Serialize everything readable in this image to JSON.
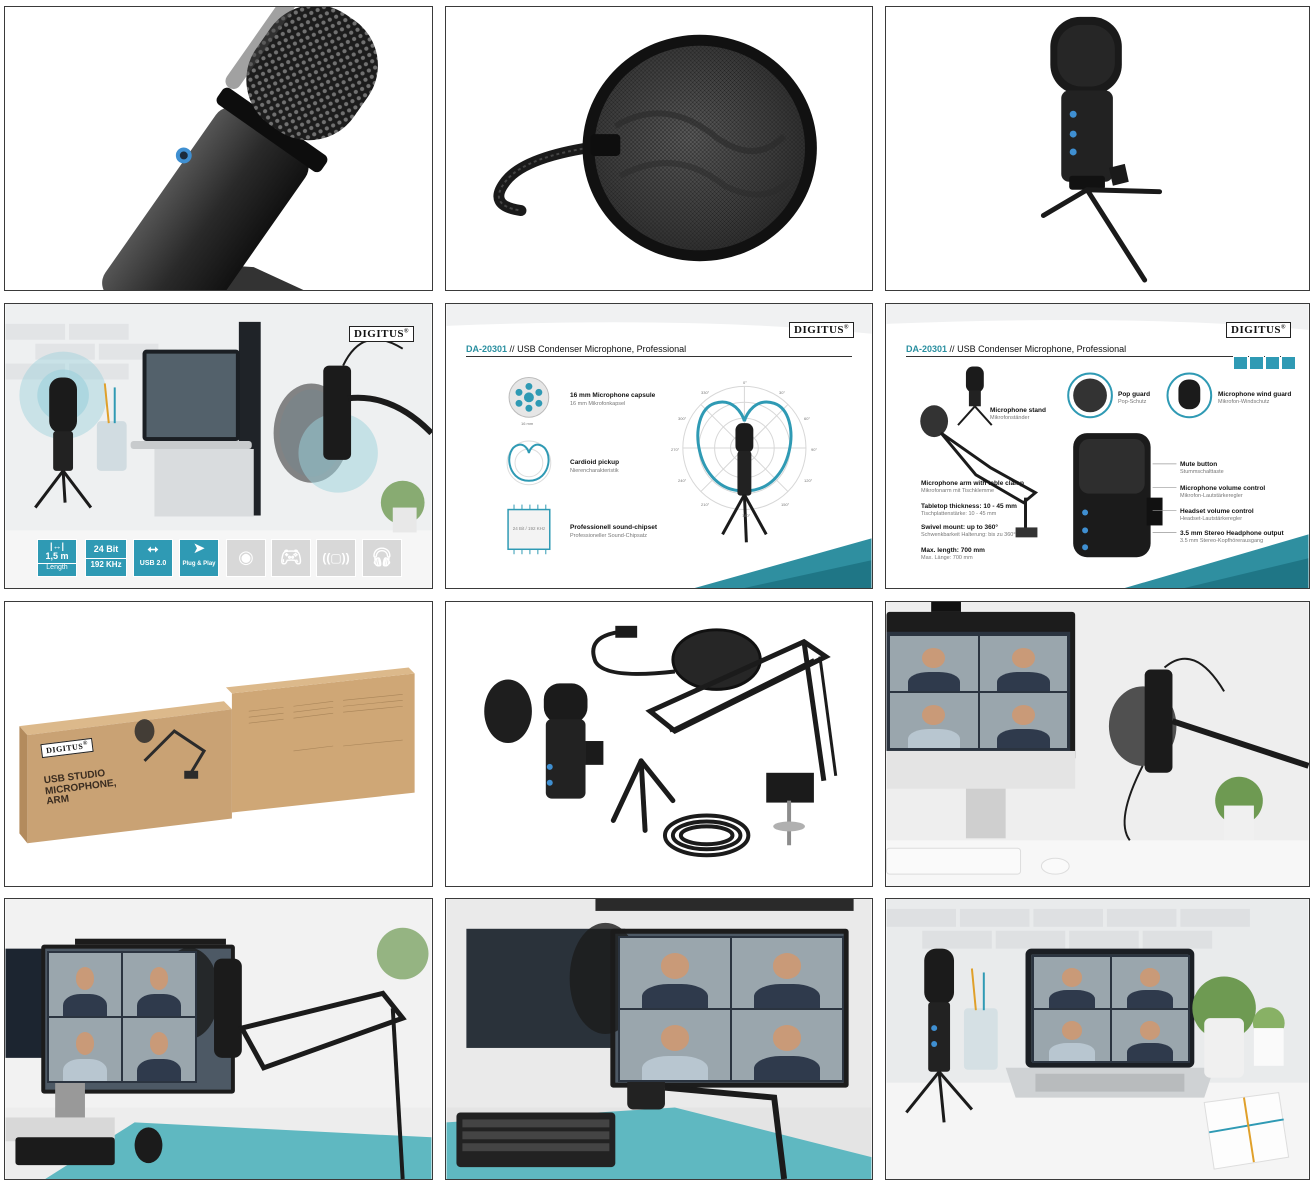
{
  "brand": {
    "logo_text": "DIGITUS",
    "reg_mark": "®"
  },
  "colors": {
    "accent": "#2f9ab4",
    "dark": "#1d1d1f",
    "kraft": "#c9a274"
  },
  "lifestyle_badges": [
    {
      "icon": "cable-length-icon",
      "line1": "1,5 m",
      "line2": "Length"
    },
    {
      "icon": "",
      "line1": "24 Bit",
      "line2": "192 KHz"
    },
    {
      "icon": "usb-icon",
      "line1": "",
      "line2": "USB 2.0"
    },
    {
      "icon": "plug-and-play-icon",
      "line1": "",
      "line2": "Plug & Play"
    },
    {
      "icon": "webcam-icon",
      "line1": "",
      "line2": ""
    },
    {
      "icon": "gamepad-icon",
      "line1": "",
      "line2": ""
    },
    {
      "icon": "signal-icon",
      "line1": "",
      "line2": ""
    },
    {
      "icon": "headphones-icon",
      "line1": "",
      "line2": ""
    }
  ],
  "infographic_features": {
    "code": "DA-20301",
    "separator": "//",
    "title": "USB Condenser Microphone, Professional",
    "items": [
      {
        "title": "16 mm Microphone capsule",
        "subtitle": "16 mm Mikrofonkapsel",
        "note": "16 mm"
      },
      {
        "title": "Cardioid pickup",
        "subtitle": "Nierencharakteristik",
        "note": ""
      },
      {
        "title": "Professionell sound-chipset",
        "subtitle": "Professioneller Sound-Chipsatz",
        "note": "24 Bit / 192 KHz"
      }
    ],
    "polar_ticks": [
      "0°",
      "30°",
      "60°",
      "90°",
      "120°",
      "150°",
      "180°",
      "210°",
      "240°",
      "270°",
      "300°",
      "330°"
    ]
  },
  "infographic_components": {
    "code": "DA-20301",
    "separator": "//",
    "title": "USB Condenser Microphone, Professional",
    "left": [
      {
        "title": "Microphone stand",
        "subtitle": "Mikrofonständer"
      },
      {
        "title": "Microphone arm with table clamp",
        "subtitle": "Mikrofonarm mit Tischklemme"
      },
      {
        "title": "Tabletop thickness: 10 - 45 mm",
        "subtitle": "Tischplattenstärke: 10 - 45 mm"
      },
      {
        "title": "Swivel mount: up to 360°",
        "subtitle": "Schwenkbarkeit Halterung: bis zu 360°"
      },
      {
        "title": "Max. length: 700 mm",
        "subtitle": "Max. Länge: 700 mm"
      }
    ],
    "top": [
      {
        "title": "Pop guard",
        "subtitle": "Pop-Schutz"
      },
      {
        "title": "Microphone wind guard",
        "subtitle": "Mikrofon-Windschutz"
      }
    ],
    "right": [
      {
        "title": "Mute button",
        "subtitle": "Stummschalttaste"
      },
      {
        "title": "Microphone volume control",
        "subtitle": "Mikrofon-Lautstärkeregler"
      },
      {
        "title": "Headset volume control",
        "subtitle": "Headset-Lautstärkeregler"
      },
      {
        "title": "3.5 mm Stereo Headphone output",
        "subtitle": "3.5 mm Stereo-Kopfhörerausgang"
      }
    ]
  },
  "packaging": {
    "line1": "USB STUDIO",
    "line2": "MICROPHONE,",
    "line3": "ARM"
  }
}
